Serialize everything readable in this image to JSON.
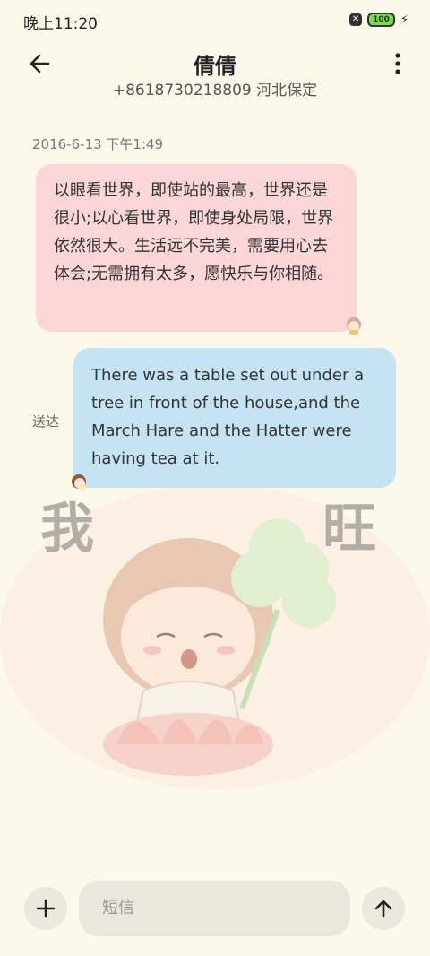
{
  "status_bar": {
    "time": "晚上11:20",
    "battery": "100",
    "icons": [
      "notification-x-icon",
      "battery-icon",
      "charging-bolt-icon"
    ]
  },
  "header": {
    "contact_name": "倩倩",
    "contact_number_location": "+8618730218809 河北保定",
    "icons": [
      "back-arrow-icon",
      "more-vertical-icon"
    ]
  },
  "conversation": {
    "timestamp": "2016-6-13 下午1:49",
    "messages": [
      {
        "direction": "incoming",
        "text": "以眼看世界，即使站的最高，世界还是很小;以心看世界，即使身处局限，世界依然很大。生活远不完美，需要用心去体会;无需拥有太多，愿快乐与你相随。",
        "color": "#fad6d7"
      },
      {
        "direction": "outgoing",
        "text": "There was a table set out under a tree in front of the house,and the March Hare and the Hatter were having tea at it.",
        "color": "#c5e3f3",
        "status": "送达"
      }
    ]
  },
  "background_sticker": {
    "description_chars": [
      "我",
      "旺"
    ]
  },
  "composer": {
    "placeholder": "短信",
    "icons": [
      "add-icon",
      "send-arrow-icon"
    ]
  }
}
